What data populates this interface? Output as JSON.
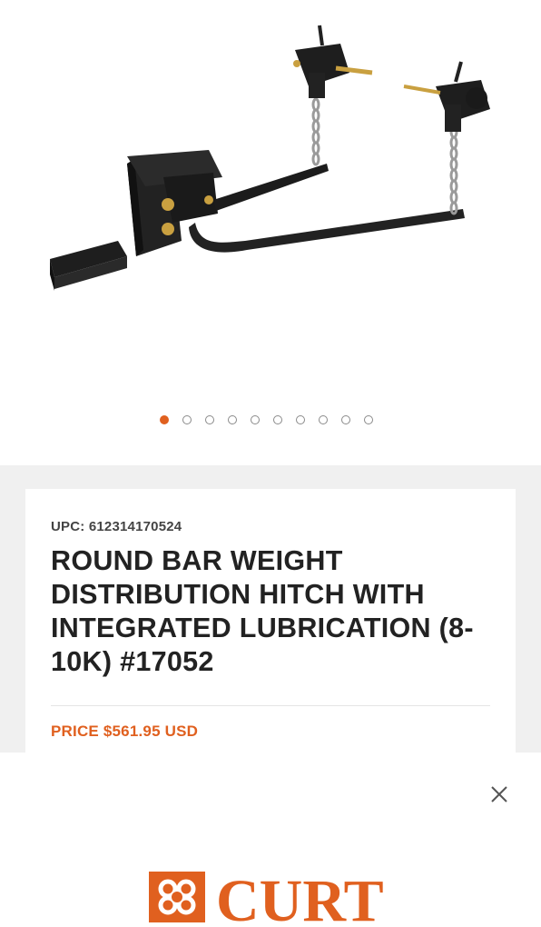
{
  "gallery": {
    "image_alt": "Round bar weight distribution hitch",
    "slide_count": 10,
    "active_slide": 1
  },
  "product": {
    "upc": "UPC: 612314170524",
    "title": "ROUND BAR WEIGHT DISTRIBUTION HITCH WITH INTEGRATED LUBRICATION (8-10K) #17052",
    "price": "PRICE $561.95 USD"
  },
  "banner": {
    "close_icon": "close-icon",
    "brand": "CURT"
  },
  "colors": {
    "accent": "#e0601f",
    "text": "#222222",
    "section_bg": "#f0f0f0"
  }
}
